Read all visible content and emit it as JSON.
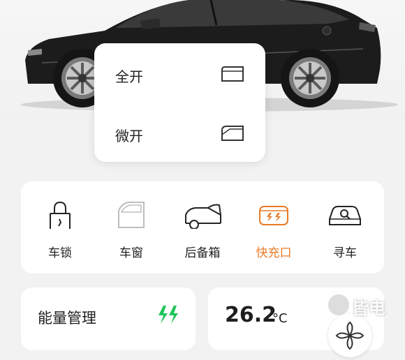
{
  "window_popup": {
    "items": [
      {
        "label": "全开",
        "icon": "window-full-open-icon"
      },
      {
        "label": "微开",
        "icon": "window-slight-open-icon"
      }
    ]
  },
  "controls": [
    {
      "label": "车锁",
      "icon": "lock-icon",
      "active": false
    },
    {
      "label": "车窗",
      "icon": "car-window-icon",
      "active": false
    },
    {
      "label": "后备箱",
      "icon": "trunk-icon",
      "active": false
    },
    {
      "label": "快充口",
      "icon": "fast-charge-port-icon",
      "active": true
    },
    {
      "label": "寻车",
      "icon": "find-car-icon",
      "active": false
    }
  ],
  "energy": {
    "title": "能量管理",
    "icon": "fast-charge-icon"
  },
  "climate": {
    "temperature": "26.2",
    "unit": "°C",
    "fan_icon": "fan-icon"
  },
  "watermark": {
    "text": "皆电"
  },
  "colors": {
    "accent": "#e97a28",
    "energy_green": "#21c45a",
    "card_bg": "#ffffff",
    "page_bg": "#f2f2f2"
  }
}
